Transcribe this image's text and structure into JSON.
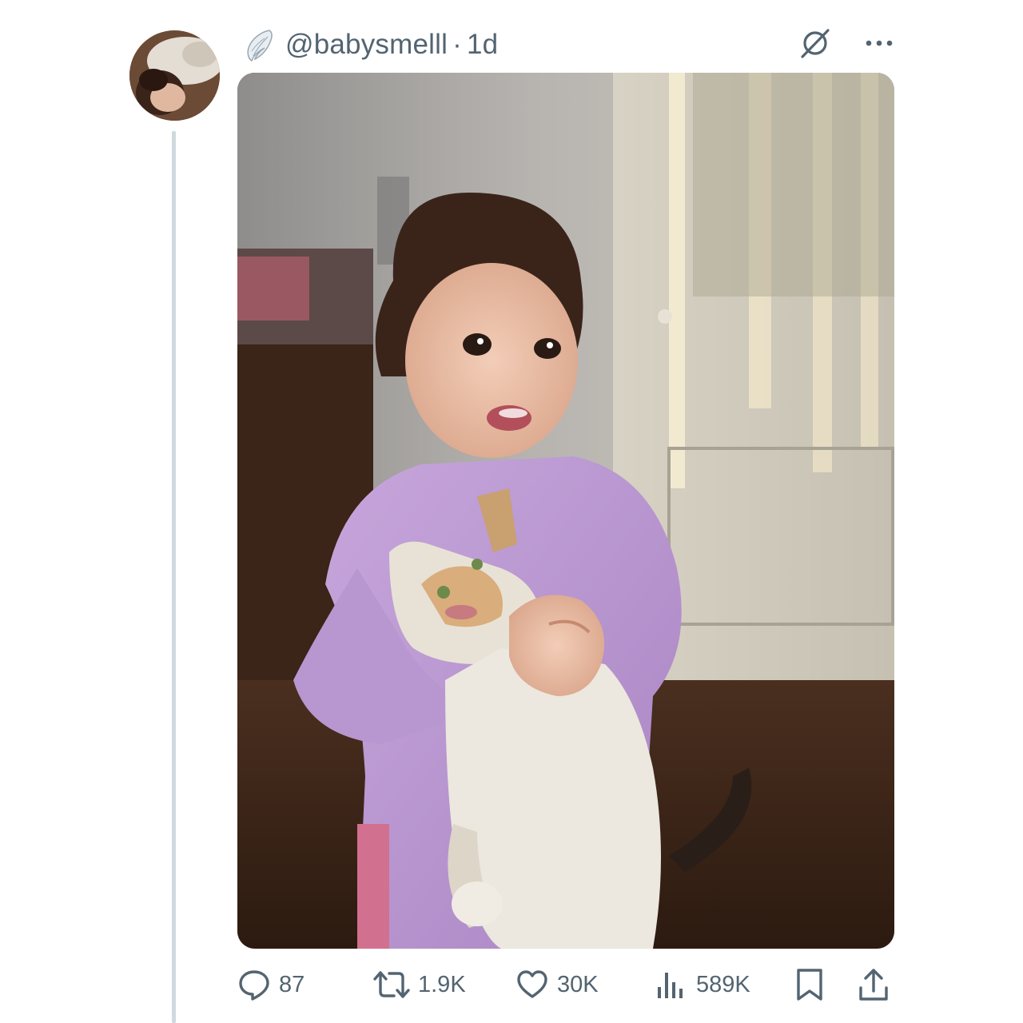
{
  "tweet": {
    "handle": "@babysmelll",
    "separator": "·",
    "time": "1d",
    "badge_icon": "angel-wing-icon",
    "grok_icon": "grok-icon",
    "more_icon": "more-dots-icon",
    "avatar_alt": "profile picture with cat and baby"
  },
  "actions": {
    "reply": {
      "icon": "reply-icon",
      "count": "87"
    },
    "retweet": {
      "icon": "retweet-icon",
      "count": "1.9K"
    },
    "like": {
      "icon": "heart-icon",
      "count": "30K"
    },
    "views": {
      "icon": "views-icon",
      "count": "589K"
    },
    "bookmark": {
      "icon": "bookmark-icon"
    },
    "share": {
      "icon": "share-icon"
    }
  },
  "colors": {
    "text_secondary": "#536471",
    "thread_line": "#cfd9de",
    "background": "#ffffff"
  }
}
